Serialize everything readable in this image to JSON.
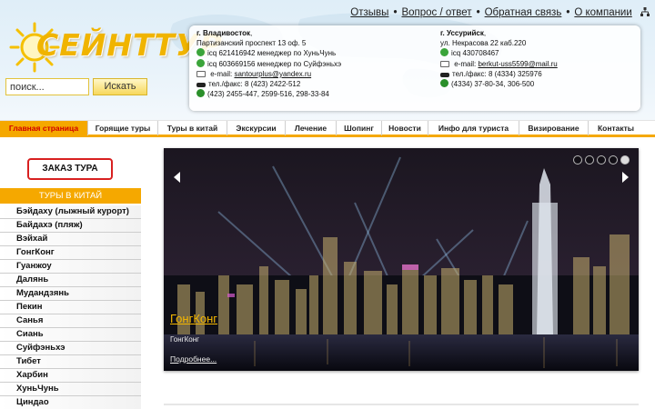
{
  "logo": {
    "text": "СЕЙНТТУР"
  },
  "search": {
    "placeholder": "поиск...",
    "value": "поиск...",
    "button_label": "Искать"
  },
  "top_links": [
    {
      "label": "Отзывы"
    },
    {
      "label": "Вопрос / ответ"
    },
    {
      "label": "Обратная связь"
    },
    {
      "label": "О компании"
    }
  ],
  "contacts": {
    "vladivostok": {
      "city": "г. Владивосток",
      "address": "Партизанский проспект 13 оф. 5",
      "icq1": "icq 621416942  менеджер по ХуньЧунь",
      "icq2": "icq 603669156 менеджер по Суйфэньхэ",
      "email_label": "e-mail:",
      "email": "santourplus@yandex.ru",
      "phone_fax": "тел./факс: 8 (423) 2422-512",
      "phones": "(423) 2455-447, 2599-516, 298-33-84"
    },
    "ussuriysk": {
      "city": "г. Уссурийск",
      "address": "ул. Некрасова 22 каб.220",
      "icq": "icq 430708467",
      "email_label": "e-mail:",
      "email": "berkut-uss5599@mail.ru",
      "phone_fax": "тел./факс: 8 (4334) 325976",
      "phones": "(4334) 37-80-34, 306-500"
    }
  },
  "nav": [
    {
      "label": "Главная страница",
      "active": true
    },
    {
      "label": "Горящие туры"
    },
    {
      "label": "Туры в китай"
    },
    {
      "label": "Экскурсии"
    },
    {
      "label": "Лечение"
    },
    {
      "label": "Шопинг"
    },
    {
      "label": "Новости"
    },
    {
      "label": "Инфо для туриста"
    },
    {
      "label": "Визирование"
    },
    {
      "label": "Контакты"
    }
  ],
  "sidebar": {
    "order_button": "ЗАКАЗ ТУРА",
    "heading": "ТУРЫ В КИТАЙ",
    "items": [
      "Бэйдаху (лыжный курорт)",
      "Байдахэ (пляж)",
      "Вэйхай",
      "ГонгКонг",
      "Гуанжоу",
      "Далянь",
      "Мудандзянь",
      "Пекин",
      "Санья",
      "Сиань",
      "Суйфэньхэ",
      "Тибет",
      "Харбин",
      "ХуньЧунь",
      "Циндао"
    ]
  },
  "slider": {
    "title": "ГонгКонг",
    "subtitle": "ГонгКонг",
    "more_link": "Подробнее...",
    "slide_count": 5,
    "active_slide": 5
  },
  "colors": {
    "accent": "#f5a800",
    "active_text": "#d00000",
    "logo": "#f0b400",
    "order_border": "#d82020"
  }
}
